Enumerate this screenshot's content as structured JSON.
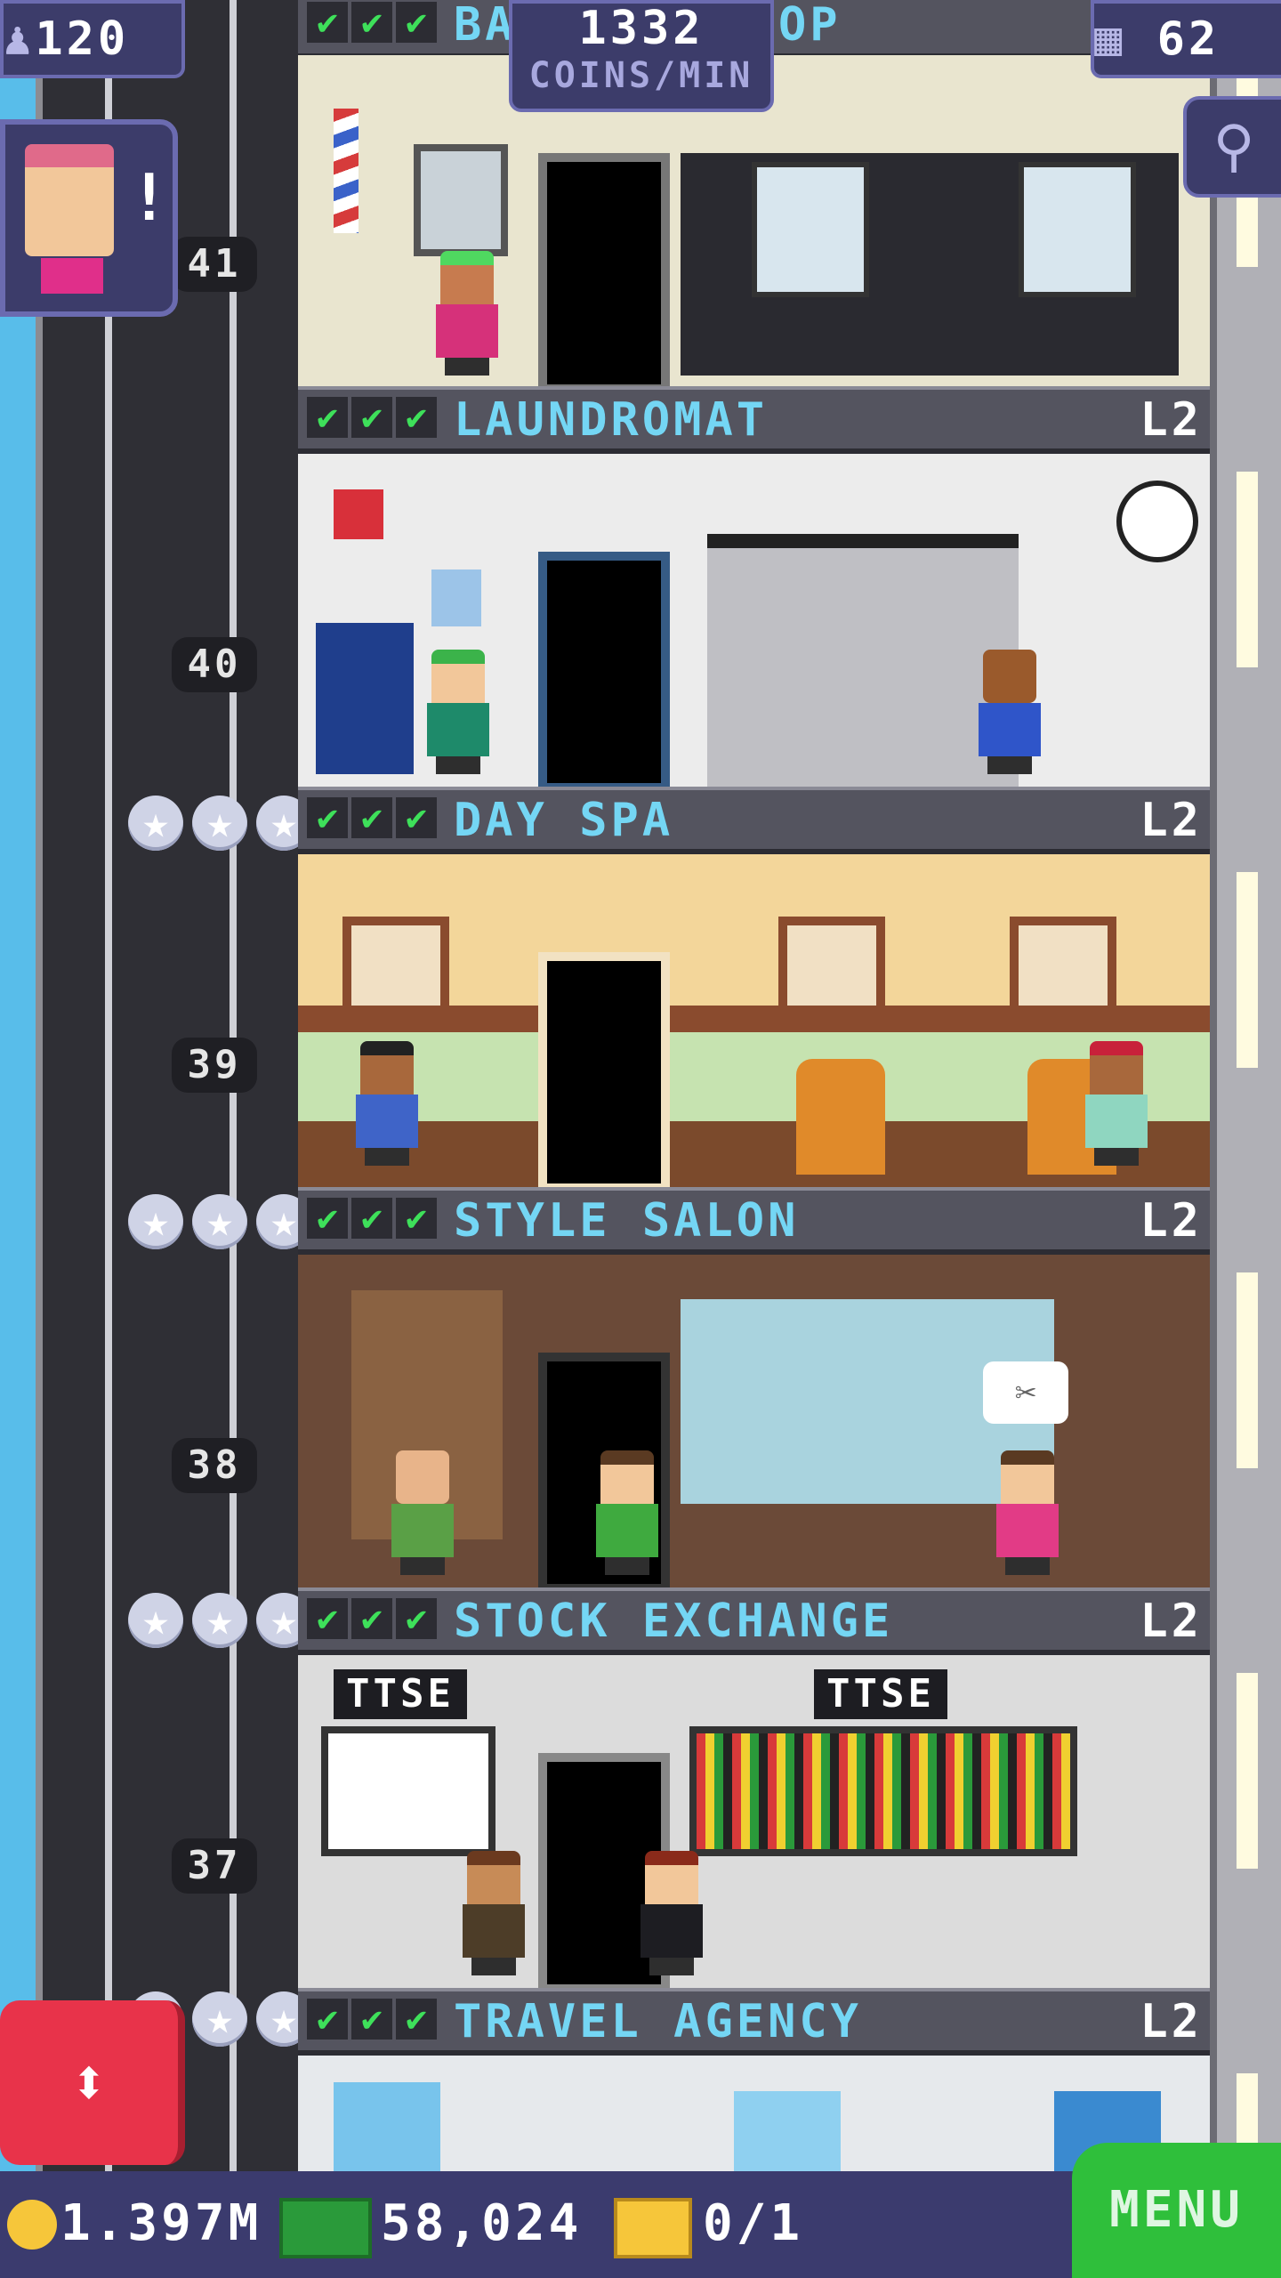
{
  "hud": {
    "population": "120",
    "coins_rate_value": "1332",
    "coins_rate_unit": "COINS/MIN",
    "floors": "62"
  },
  "notification": {
    "marker": "!"
  },
  "shaft_floors": [
    "41",
    "40",
    "39",
    "38",
    "37"
  ],
  "rooms": [
    {
      "name": "BARBER SHOP",
      "visible_name": "BA",
      "visible_name_tail": "OP",
      "level": "",
      "checks": [
        "✔",
        "✔",
        "✔"
      ]
    },
    {
      "name": "LAUNDROMAT",
      "level": "L2",
      "checks": [
        "✔",
        "✔",
        "✔"
      ]
    },
    {
      "name": "DAY SPA",
      "level": "L2",
      "checks": [
        "✔",
        "✔",
        "✔"
      ]
    },
    {
      "name": "STYLE SALON",
      "level": "L2",
      "checks": [
        "✔",
        "✔",
        "✔"
      ]
    },
    {
      "name": "STOCK EXCHANGE",
      "level": "L2",
      "checks": [
        "✔",
        "✔",
        "✔"
      ],
      "signs": [
        "TTSE",
        "TTSE"
      ]
    },
    {
      "name": "TRAVEL AGENCY",
      "level": "L2",
      "checks": [
        "✔",
        "✔",
        "✔"
      ]
    }
  ],
  "bottom_bar": {
    "coins": "1.397M",
    "bux": "58,024",
    "tickets": "0/1",
    "menu_label": "MENU"
  },
  "colors": {
    "sky": "#58bdea",
    "room_title": "#74d6f4",
    "check": "#3ee05a",
    "menu_green": "#2fbf3b",
    "elevator_red": "#e8334a",
    "hud_bg": "#3c3c6a"
  },
  "icons": [
    "population-icon",
    "floors-icon",
    "magnifier-icon",
    "coin-icon",
    "bux-icon",
    "ticket-icon",
    "elevator-arrows-icon"
  ]
}
